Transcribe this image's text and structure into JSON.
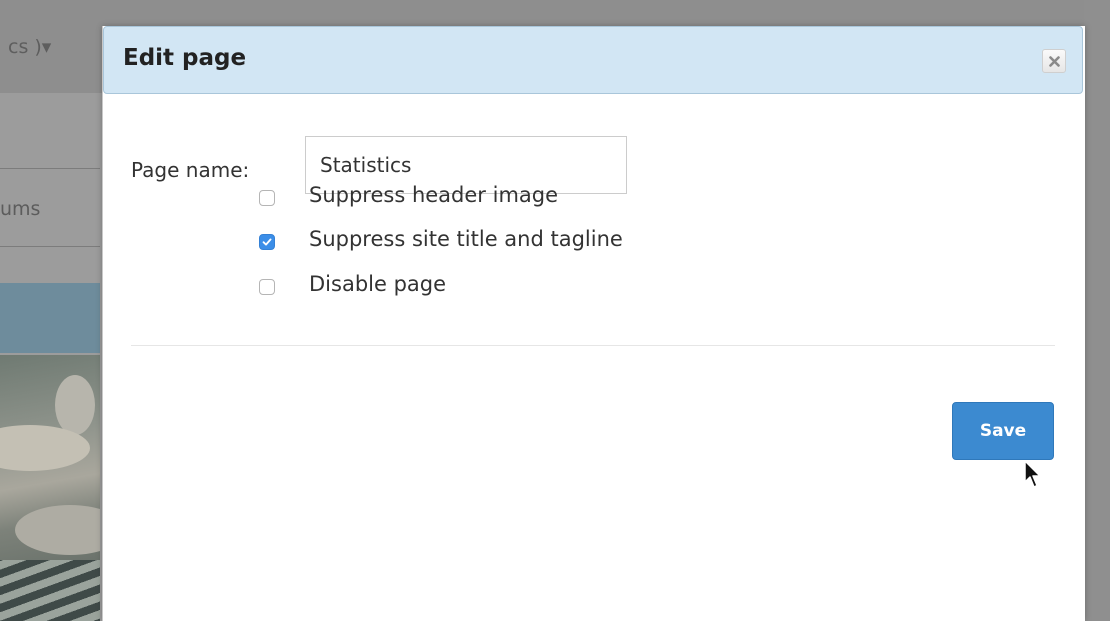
{
  "background": {
    "topbar_text": "cs )▾",
    "nav_text": "ums"
  },
  "dialog": {
    "title": "Edit page",
    "close_icon": "close-icon",
    "header_color": "#d2e6f4",
    "page_name_label": "Page name:",
    "page_name_value": "Statistics",
    "options": [
      {
        "label": "Suppress header image",
        "checked": false
      },
      {
        "label": "Suppress site title and tagline",
        "checked": true
      },
      {
        "label": "Disable page",
        "checked": false
      }
    ],
    "save_label": "Save",
    "accent_color": "#3c8ad0"
  }
}
